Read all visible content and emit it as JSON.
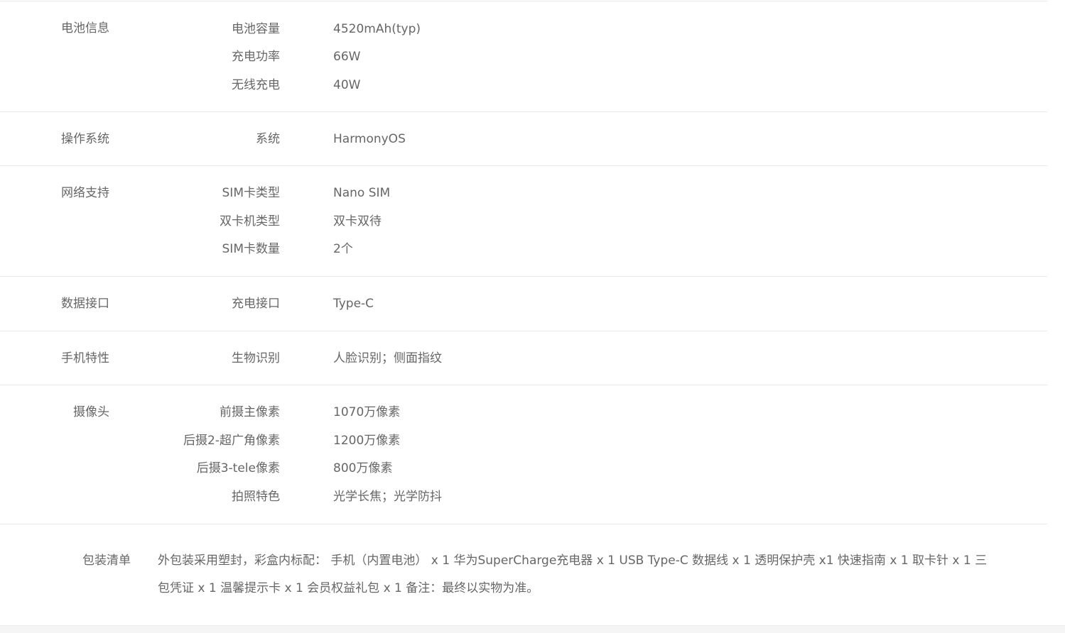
{
  "groups": [
    {
      "title": "电池信息",
      "rows": [
        {
          "key": "电池容量",
          "value": "4520mAh(typ)"
        },
        {
          "key": "充电功率",
          "value": "66W"
        },
        {
          "key": "无线充电",
          "value": "40W"
        }
      ]
    },
    {
      "title": "操作系统",
      "rows": [
        {
          "key": "系统",
          "value": "HarmonyOS"
        }
      ]
    },
    {
      "title": "网络支持",
      "rows": [
        {
          "key": "SIM卡类型",
          "value": "Nano SIM"
        },
        {
          "key": "双卡机类型",
          "value": "双卡双待"
        },
        {
          "key": "SIM卡数量",
          "value": "2个"
        }
      ]
    },
    {
      "title": "数据接口",
      "rows": [
        {
          "key": "充电接口",
          "value": "Type-C"
        }
      ]
    },
    {
      "title": "手机特性",
      "rows": [
        {
          "key": "生物识别",
          "value": "人脸识别；侧面指纹"
        }
      ]
    },
    {
      "title": "摄像头",
      "rows": [
        {
          "key": "前摄主像素",
          "value": "1070万像素"
        },
        {
          "key": "后摄2-超广角像素",
          "value": "1200万像素"
        },
        {
          "key": "后摄3-tele像素",
          "value": "800万像素"
        },
        {
          "key": "拍照特色",
          "value": "光学长焦；光学防抖"
        }
      ]
    }
  ],
  "package": {
    "title": "包装清单",
    "text": "外包装采用塑封，彩盒内标配： 手机（内置电池） x 1 华为SuperCharge充电器 x 1 USB Type-C 数据线 x 1 透明保护壳 x1 快速指南 x 1 取卡针 x 1 三包凭证 x 1 温馨提示卡 x 1 会员权益礼包 x 1 备注：最终以实物为准。"
  }
}
